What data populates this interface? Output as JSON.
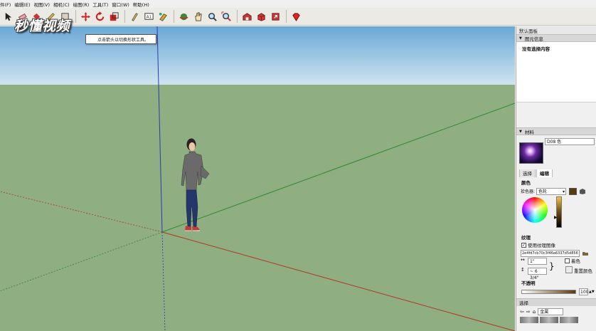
{
  "menu": {
    "items": [
      "件(F)",
      "编辑(E)",
      "视图(V)",
      "相机(C)",
      "绘图(R)",
      "工具(T)",
      "窗口(W)",
      "帮助(H)"
    ]
  },
  "logo": {
    "text": "秒懂视频"
  },
  "tooltip": {
    "text": "点击箭头以切换形状工具。"
  },
  "tray": {
    "title": "默认面板",
    "entity_info": {
      "header": "图元信息",
      "empty_text": "没有选择内容"
    },
    "materials": {
      "header": "材料",
      "material_name": "D08 色",
      "tabs": {
        "select": "选择",
        "edit": "编辑"
      },
      "color_label": "颜色",
      "picker_label": "拾色器:",
      "picker_value": "色轮",
      "texture_label": "纹理",
      "use_texture_label": "使用纹理图像",
      "texture_file": "2e4fd7cb70c3f46a6337d5d856",
      "width_value": "1\"",
      "height_value": "~ 6 3/4\"",
      "colorize_label": "着色",
      "reset_color_label": "重置颜色",
      "opacity_label": "不透明",
      "opacity_value": "100"
    },
    "select_panel": {
      "header": "选择",
      "library_value": "金属"
    }
  },
  "colors": {
    "sky_top": "#6aa7d6",
    "sky_bottom": "#cfe4f0",
    "ground": "#8fae82",
    "axis_red": "#b0381f",
    "axis_green": "#2f8a2a",
    "axis_blue": "#2a3ab0"
  },
  "icons": [
    "select-icon",
    "eraser-icon",
    "paint-bucket-icon",
    "pencil-icon",
    "rectangle-icon",
    "move-icon",
    "rotate-icon",
    "scale-icon",
    "tape-measure-icon",
    "text-icon",
    "paint-icon",
    "orbit-icon",
    "pan-icon",
    "zoom-icon",
    "zoom-extents-icon",
    "warehouse-icon",
    "components-icon",
    "share-icon",
    "ruby-icon"
  ]
}
